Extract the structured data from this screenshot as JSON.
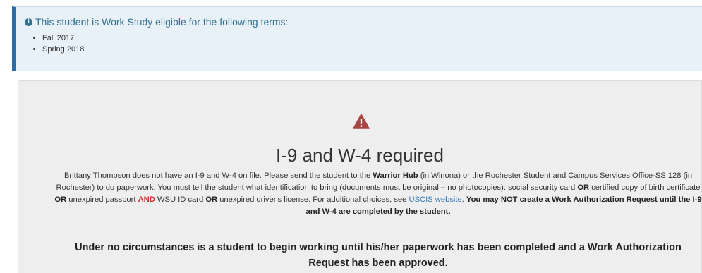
{
  "info_alert": {
    "title": "This student is Work Study eligible for the following terms:",
    "icon": "info-circle-icon",
    "terms": [
      "Fall 2017",
      "Spring 2018"
    ]
  },
  "warning": {
    "icon": "warning-triangle-icon",
    "icon_color": "#a94442",
    "title": "I-9 and W-4 required",
    "body": {
      "p1": "Brittany Thompson does not have an I-9 and W-4 on file. Please send the student to the ",
      "warrior_hub": "Warrior Hub",
      "p2": " (in Winona) or the Rochester Student and Campus Services Office-SS 128 (in Rochester) to do paperwork. You must tell the student what identification to bring (documents must be original – no photocopies): social security card ",
      "or1": "OR",
      "p3": " certified copy of birth certificate ",
      "or2": "OR",
      "p4": " unexpired passport ",
      "and": "AND",
      "p5": " WSU ID card ",
      "or3": "OR",
      "p6": " unexpired driver's license. For additional choices, see ",
      "link": "USCIS website",
      "p7": ". ",
      "closing_bold": "You may NOT create a Work Authorization Request until the I-9 and W-4 are completed by the student."
    },
    "footer": "Under no circumstances is a student to begin working until his/her paperwork has been completed and a Work Authorization Request has been approved."
  }
}
